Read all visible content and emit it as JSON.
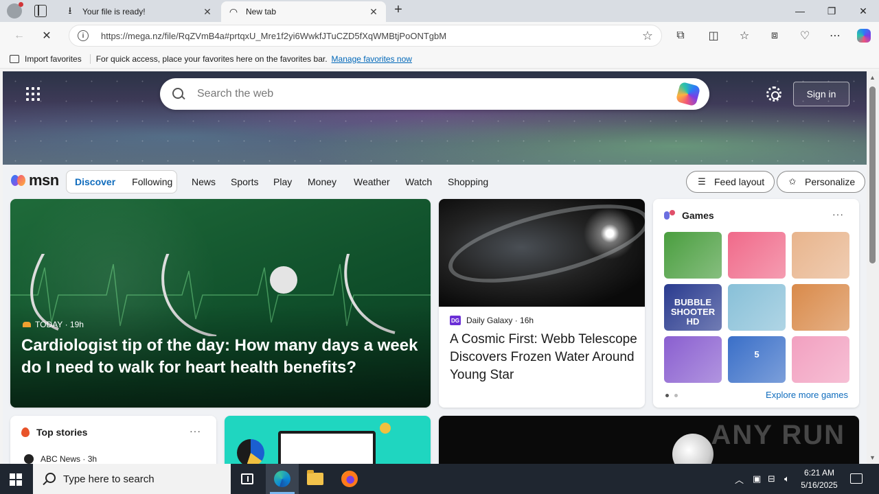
{
  "browser": {
    "tabs": [
      {
        "label": "Your file is ready!",
        "icon": "download-icon",
        "active": false
      },
      {
        "label": "New tab",
        "icon": "loading-icon",
        "active": true
      }
    ],
    "url": "https://mega.nz/file/RqZVmB4a#prtqxU_Mre1f2yi6WwkfJTuCZD5fXqWMBtjPoONTgbM",
    "favorites_bar": {
      "import_label": "Import favorites",
      "message": "For quick access, place your favorites here on the favorites bar.",
      "link": "Manage favorites now"
    }
  },
  "msn": {
    "search_placeholder": "Search the web",
    "sign_in": "Sign in",
    "logo_text": "msn",
    "segments": [
      "Discover",
      "Following"
    ],
    "nav": [
      "News",
      "Sports",
      "Play",
      "Money",
      "Weather",
      "Watch",
      "Shopping"
    ],
    "feed_layout": "Feed layout",
    "personalize": "Personalize",
    "big_card": {
      "source": "TODAY",
      "time": "19h",
      "headline": "Cardiologist tip of the day: How many days a week do I need to walk for heart health benefits?"
    },
    "space_card": {
      "source": "Daily Galaxy",
      "time": "16h",
      "headline": "A Cosmic First: Webb Telescope Discovers Frozen Water Around Young Star",
      "source_logo": "DG"
    },
    "games": {
      "title": "Games",
      "more": "···",
      "explore": "Explore more games",
      "tile_colors": [
        "#4a9e3f",
        "#f06a8a",
        "#e8b48c",
        "#2a3b8f",
        "#88c0d8",
        "#d98a4a",
        "#8a5fd0",
        "#3a6fc8",
        "#f2a0c0"
      ],
      "tile_texts": [
        "",
        "",
        "",
        "BUBBLE SHOOTER HD",
        "",
        "",
        "",
        "5",
        ""
      ]
    },
    "top_stories": {
      "title": "Top stories",
      "more": "···",
      "source": "ABC News",
      "time": "3h"
    },
    "watermark": "ANY RUN"
  },
  "taskbar": {
    "search_placeholder": "Type here to search",
    "time": "6:21 AM",
    "date": "5/16/2025"
  }
}
